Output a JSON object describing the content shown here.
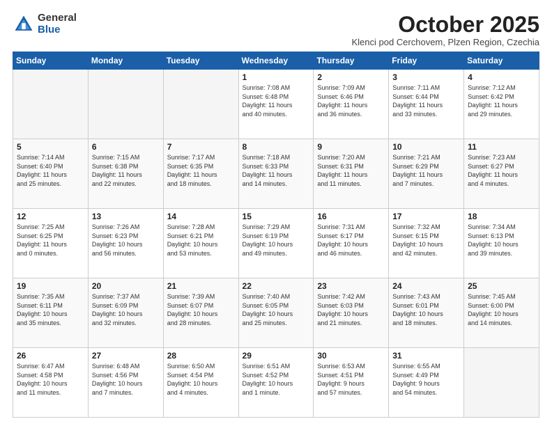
{
  "logo": {
    "general": "General",
    "blue": "Blue"
  },
  "title": "October 2025",
  "location": "Klenci pod Cerchovem, Plzen Region, Czechia",
  "days_of_week": [
    "Sunday",
    "Monday",
    "Tuesday",
    "Wednesday",
    "Thursday",
    "Friday",
    "Saturday"
  ],
  "weeks": [
    [
      {
        "day": "",
        "info": ""
      },
      {
        "day": "",
        "info": ""
      },
      {
        "day": "",
        "info": ""
      },
      {
        "day": "1",
        "info": "Sunrise: 7:08 AM\nSunset: 6:48 PM\nDaylight: 11 hours\nand 40 minutes."
      },
      {
        "day": "2",
        "info": "Sunrise: 7:09 AM\nSunset: 6:46 PM\nDaylight: 11 hours\nand 36 minutes."
      },
      {
        "day": "3",
        "info": "Sunrise: 7:11 AM\nSunset: 6:44 PM\nDaylight: 11 hours\nand 33 minutes."
      },
      {
        "day": "4",
        "info": "Sunrise: 7:12 AM\nSunset: 6:42 PM\nDaylight: 11 hours\nand 29 minutes."
      }
    ],
    [
      {
        "day": "5",
        "info": "Sunrise: 7:14 AM\nSunset: 6:40 PM\nDaylight: 11 hours\nand 25 minutes."
      },
      {
        "day": "6",
        "info": "Sunrise: 7:15 AM\nSunset: 6:38 PM\nDaylight: 11 hours\nand 22 minutes."
      },
      {
        "day": "7",
        "info": "Sunrise: 7:17 AM\nSunset: 6:35 PM\nDaylight: 11 hours\nand 18 minutes."
      },
      {
        "day": "8",
        "info": "Sunrise: 7:18 AM\nSunset: 6:33 PM\nDaylight: 11 hours\nand 14 minutes."
      },
      {
        "day": "9",
        "info": "Sunrise: 7:20 AM\nSunset: 6:31 PM\nDaylight: 11 hours\nand 11 minutes."
      },
      {
        "day": "10",
        "info": "Sunrise: 7:21 AM\nSunset: 6:29 PM\nDaylight: 11 hours\nand 7 minutes."
      },
      {
        "day": "11",
        "info": "Sunrise: 7:23 AM\nSunset: 6:27 PM\nDaylight: 11 hours\nand 4 minutes."
      }
    ],
    [
      {
        "day": "12",
        "info": "Sunrise: 7:25 AM\nSunset: 6:25 PM\nDaylight: 11 hours\nand 0 minutes."
      },
      {
        "day": "13",
        "info": "Sunrise: 7:26 AM\nSunset: 6:23 PM\nDaylight: 10 hours\nand 56 minutes."
      },
      {
        "day": "14",
        "info": "Sunrise: 7:28 AM\nSunset: 6:21 PM\nDaylight: 10 hours\nand 53 minutes."
      },
      {
        "day": "15",
        "info": "Sunrise: 7:29 AM\nSunset: 6:19 PM\nDaylight: 10 hours\nand 49 minutes."
      },
      {
        "day": "16",
        "info": "Sunrise: 7:31 AM\nSunset: 6:17 PM\nDaylight: 10 hours\nand 46 minutes."
      },
      {
        "day": "17",
        "info": "Sunrise: 7:32 AM\nSunset: 6:15 PM\nDaylight: 10 hours\nand 42 minutes."
      },
      {
        "day": "18",
        "info": "Sunrise: 7:34 AM\nSunset: 6:13 PM\nDaylight: 10 hours\nand 39 minutes."
      }
    ],
    [
      {
        "day": "19",
        "info": "Sunrise: 7:35 AM\nSunset: 6:11 PM\nDaylight: 10 hours\nand 35 minutes."
      },
      {
        "day": "20",
        "info": "Sunrise: 7:37 AM\nSunset: 6:09 PM\nDaylight: 10 hours\nand 32 minutes."
      },
      {
        "day": "21",
        "info": "Sunrise: 7:39 AM\nSunset: 6:07 PM\nDaylight: 10 hours\nand 28 minutes."
      },
      {
        "day": "22",
        "info": "Sunrise: 7:40 AM\nSunset: 6:05 PM\nDaylight: 10 hours\nand 25 minutes."
      },
      {
        "day": "23",
        "info": "Sunrise: 7:42 AM\nSunset: 6:03 PM\nDaylight: 10 hours\nand 21 minutes."
      },
      {
        "day": "24",
        "info": "Sunrise: 7:43 AM\nSunset: 6:01 PM\nDaylight: 10 hours\nand 18 minutes."
      },
      {
        "day": "25",
        "info": "Sunrise: 7:45 AM\nSunset: 6:00 PM\nDaylight: 10 hours\nand 14 minutes."
      }
    ],
    [
      {
        "day": "26",
        "info": "Sunrise: 6:47 AM\nSunset: 4:58 PM\nDaylight: 10 hours\nand 11 minutes."
      },
      {
        "day": "27",
        "info": "Sunrise: 6:48 AM\nSunset: 4:56 PM\nDaylight: 10 hours\nand 7 minutes."
      },
      {
        "day": "28",
        "info": "Sunrise: 6:50 AM\nSunset: 4:54 PM\nDaylight: 10 hours\nand 4 minutes."
      },
      {
        "day": "29",
        "info": "Sunrise: 6:51 AM\nSunset: 4:52 PM\nDaylight: 10 hours\nand 1 minute."
      },
      {
        "day": "30",
        "info": "Sunrise: 6:53 AM\nSunset: 4:51 PM\nDaylight: 9 hours\nand 57 minutes."
      },
      {
        "day": "31",
        "info": "Sunrise: 6:55 AM\nSunset: 4:49 PM\nDaylight: 9 hours\nand 54 minutes."
      },
      {
        "day": "",
        "info": ""
      }
    ]
  ]
}
